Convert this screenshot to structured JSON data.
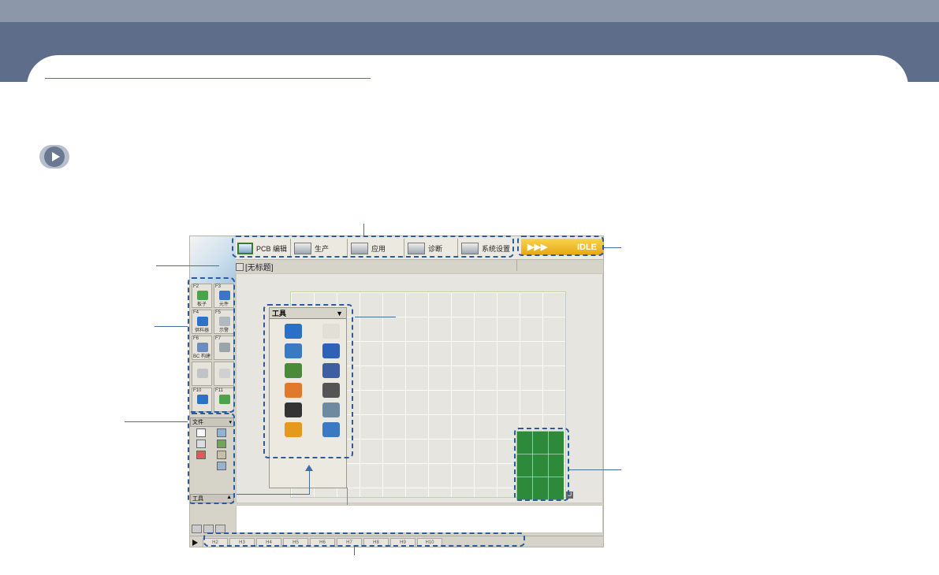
{
  "menu": {
    "items": [
      {
        "label": "PCB 编辑",
        "icon": "pcb-edit-icon"
      },
      {
        "label": "生产",
        "icon": "production-icon"
      },
      {
        "label": "应用",
        "icon": "application-icon"
      },
      {
        "label": "诊断",
        "icon": "diagnosis-icon"
      },
      {
        "label": "系统设置",
        "icon": "system-settings-icon"
      }
    ],
    "status_arrows": "▶▶▶",
    "status": "IDLE"
  },
  "document": {
    "title": "[无标题]"
  },
  "function_keys": [
    {
      "key": "F2",
      "label": "板子",
      "color": "#4ca44a"
    },
    {
      "key": "F3",
      "label": "元件",
      "color": "#3a75c6"
    },
    {
      "key": "F4",
      "label": "供料器",
      "color": "#2c73c7"
    },
    {
      "key": "F5",
      "label": "示警",
      "color": "#b0b8c0"
    },
    {
      "key": "F6",
      "label": "BC 构建",
      "color": "#6a8cc0"
    },
    {
      "key": "F7",
      "label": "",
      "color": "#9aa4aa"
    },
    {
      "key": "",
      "label": "",
      "color": "#c0c4c6"
    },
    {
      "key": "",
      "label": "",
      "color": "#d0d0d0"
    },
    {
      "key": "F10",
      "label": "",
      "color": "#2c73c7"
    },
    {
      "key": "F11",
      "label": "",
      "color": "#4ca44a"
    }
  ],
  "file_panel": {
    "title": "文件"
  },
  "tools_panel": {
    "title": "工具",
    "chevron": "▼",
    "icons": [
      {
        "name": "home-icon",
        "color": "#2a6fc9"
      },
      {
        "name": "board-view-icon",
        "color": "#e2dfd6"
      },
      {
        "name": "axis-move-icon",
        "color": "#3a79c4"
      },
      {
        "name": "operator-icon",
        "color": "#2d62b8"
      },
      {
        "name": "conveyor-icon",
        "color": "#4b8a38"
      },
      {
        "name": "xyz-axis-icon",
        "color": "#3d5ea0"
      },
      {
        "name": "nozzle-tool-icon",
        "color": "#e07a2a"
      },
      {
        "name": "alert-icon",
        "color": "#555555"
      },
      {
        "name": "auto-icon",
        "color": "#333333"
      },
      {
        "name": "feeder-tool-icon",
        "color": "#6e8aa0"
      },
      {
        "name": "gear-icon",
        "color": "#e59a1d"
      },
      {
        "name": "list-icon",
        "color": "#3a79c4"
      }
    ]
  },
  "left_bottom_label": {
    "title": "工具",
    "chevron": "▲"
  },
  "pcb_tag": "U",
  "fkeys_bar": [
    "H2",
    "H3",
    "H4",
    "H5",
    "H6",
    "H7",
    "H8",
    "H9",
    "H10"
  ]
}
